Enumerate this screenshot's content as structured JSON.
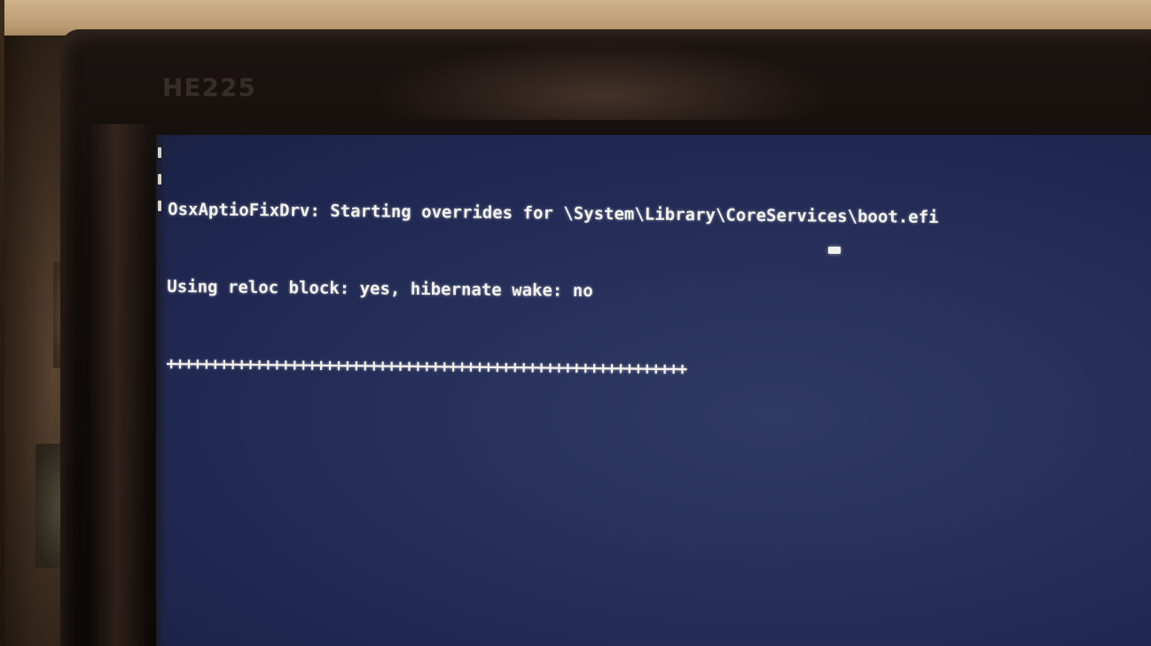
{
  "monitor": {
    "brand_label": "HE225"
  },
  "screen": {
    "lines": [
      "OsxAptioFixDrv: Starting overrides for \\System\\Library\\CoreServices\\boot.efi",
      "Using reloc block: yes, hibernate wake: no",
      "+++++++++++++++++++++++++++++++++++++++++++++++++++++++++++"
    ],
    "cursor": "_"
  },
  "colors": {
    "screen_background": "#26305a",
    "terminal_text": "#f4f1ec",
    "bezel": "#120d0b"
  }
}
